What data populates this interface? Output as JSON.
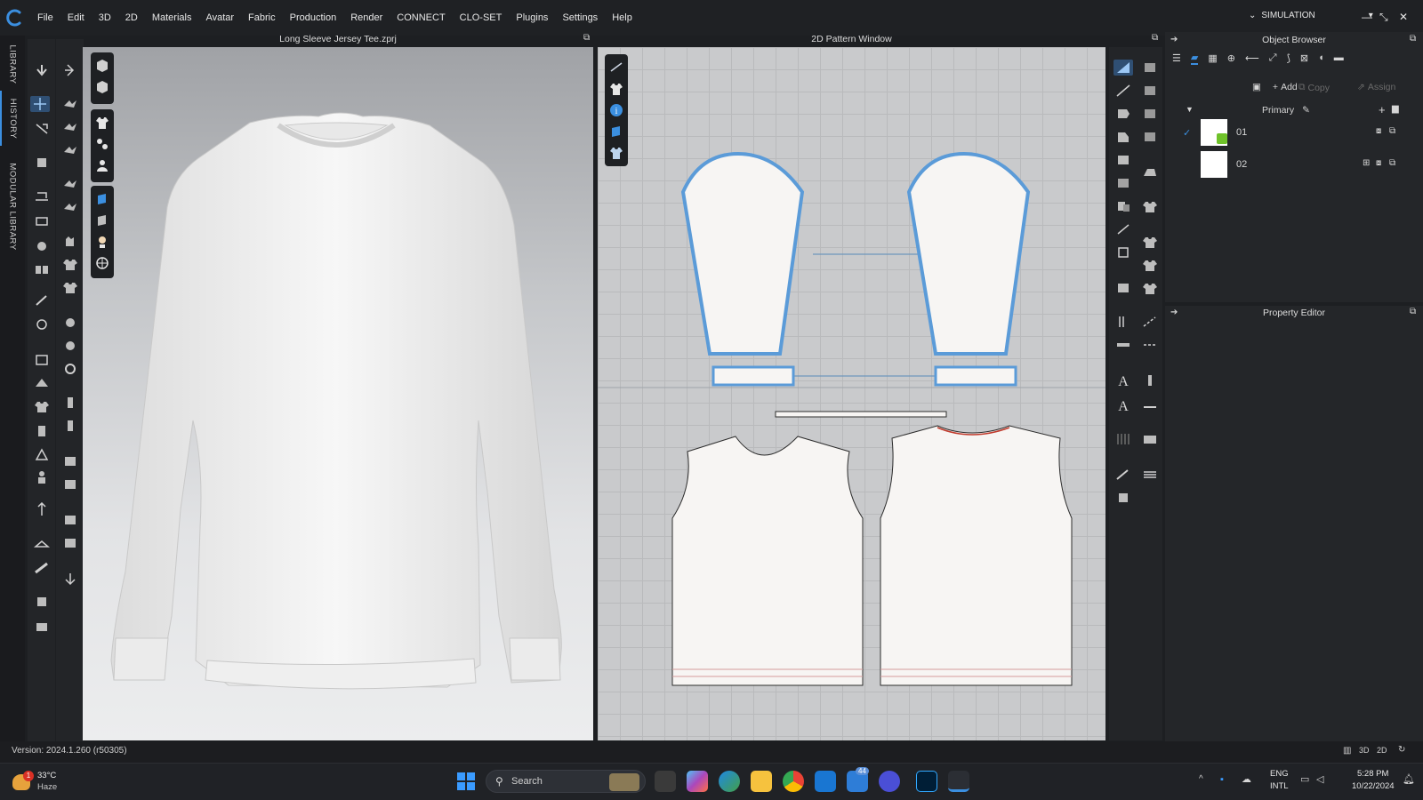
{
  "app": {
    "name": "CLO",
    "menu": [
      "File",
      "Edit",
      "3D",
      "2D",
      "Materials",
      "Avatar",
      "Fabric",
      "Production",
      "Render",
      "CONNECT",
      "CLO-SET",
      "Plugins",
      "Settings",
      "Help"
    ],
    "mode": "SIMULATION"
  },
  "side_tabs": [
    "LIBRARY",
    "HISTORY",
    "MODULAR LIBRARY"
  ],
  "view3d": {
    "title": "Long Sleeve Jersey Tee.zprj"
  },
  "view2d": {
    "title": "2D Pattern Window"
  },
  "object_browser": {
    "title": "Object Browser",
    "actions": {
      "add": "Add",
      "copy": "Copy",
      "assign": "Assign"
    },
    "group": "Primary",
    "items": [
      {
        "label": "01",
        "checked": true
      },
      {
        "label": "02",
        "checked": false
      }
    ]
  },
  "property_editor": {
    "title": "Property Editor"
  },
  "status": {
    "version": "Version: 2024.1.260 (r50305)",
    "view_buttons": [
      "3D",
      "2D"
    ]
  },
  "taskbar": {
    "weather": {
      "temp": "33°C",
      "desc": "Haze",
      "badge": "1"
    },
    "search_placeholder": "Search",
    "badge_count": "44",
    "lang": {
      "line1": "ENG",
      "line2": "INTL"
    },
    "clock": {
      "time": "5:28 PM",
      "date": "10/22/2024"
    }
  },
  "colors": {
    "accent": "#3b8fe0",
    "pattern_outline": "#5b9bd8",
    "seam_red": "#c0392b",
    "ob_icon_green": "#6fc22a"
  }
}
